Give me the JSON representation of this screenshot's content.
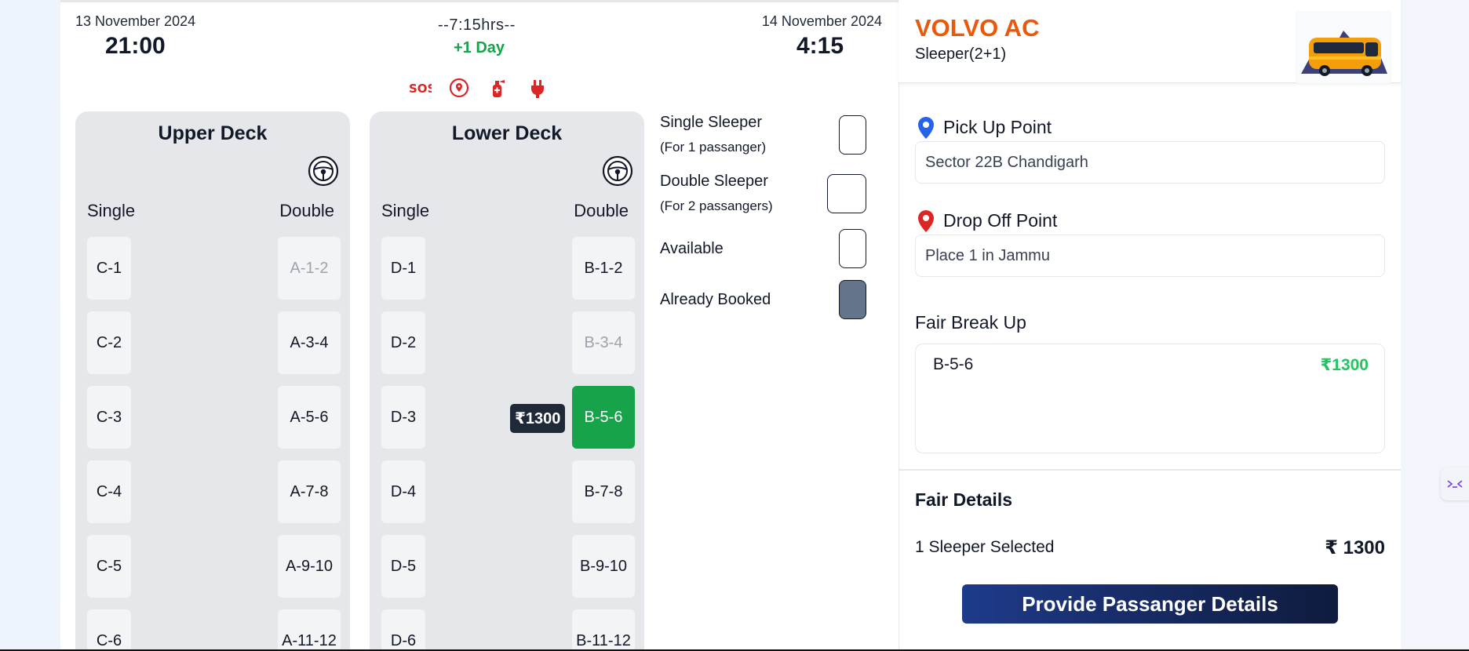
{
  "journey": {
    "departure_date": "13 November 2024",
    "departure_time": "21:00",
    "duration": "--7:15hrs--",
    "day_offset": "+1 Day",
    "arrival_date": "14 November 2024",
    "arrival_time": "4:15"
  },
  "amenities": [
    {
      "icon": "sos-icon",
      "label": "SOS"
    },
    {
      "icon": "live-tracking-icon"
    },
    {
      "icon": "fire-extinguisher-icon"
    },
    {
      "icon": "charging-plug-icon"
    }
  ],
  "upper_deck": {
    "title": "Upper Deck",
    "single_label": "Single",
    "double_label": "Double",
    "single_seats": [
      "C-1",
      "C-2",
      "C-3",
      "C-4",
      "C-5",
      "C-6"
    ],
    "double_seats": [
      "A-1-2",
      "A-3-4",
      "A-5-6",
      "A-7-8",
      "A-9-10",
      "A-11-12"
    ],
    "booked": [
      "A-1-2"
    ]
  },
  "lower_deck": {
    "title": "Lower Deck",
    "single_label": "Single",
    "double_label": "Double",
    "single_seats": [
      "D-1",
      "D-2",
      "D-3",
      "D-4",
      "D-5",
      "D-6"
    ],
    "double_seats": [
      "B-1-2",
      "B-3-4",
      "B-5-6",
      "B-7-8",
      "B-9-10",
      "B-11-12"
    ],
    "booked": [
      "B-3-4"
    ],
    "selected": "B-5-6",
    "selected_price": "₹1300"
  },
  "legend": {
    "single_sleeper": "Single Sleeper",
    "single_sub": "(For 1 passanger)",
    "double_sleeper": "Double Sleeper",
    "double_sub": "(For 2 passangers)",
    "available": "Available",
    "booked": "Already Booked",
    "booked_color": "#64748b"
  },
  "bus": {
    "name": "VOLVO AC",
    "type": "Sleeper(2+1)",
    "brand_color": "#ea580c"
  },
  "pickup": {
    "label": "Pick Up Point",
    "value": "Sector 22B Chandigarh"
  },
  "dropoff": {
    "label": "Drop Off Point",
    "value": "Place 1 in Jammu"
  },
  "fare_breakup": {
    "title": "Fair Break Up",
    "items": [
      {
        "seat": "B-5-6",
        "amount": "₹1300"
      }
    ]
  },
  "fare_details": {
    "title": "Fair Details",
    "selected_text": "1 Sleeper Selected",
    "total": "₹ 1300"
  },
  "cta_label": "Provide Passanger Details",
  "accent_green": "#16a34a"
}
